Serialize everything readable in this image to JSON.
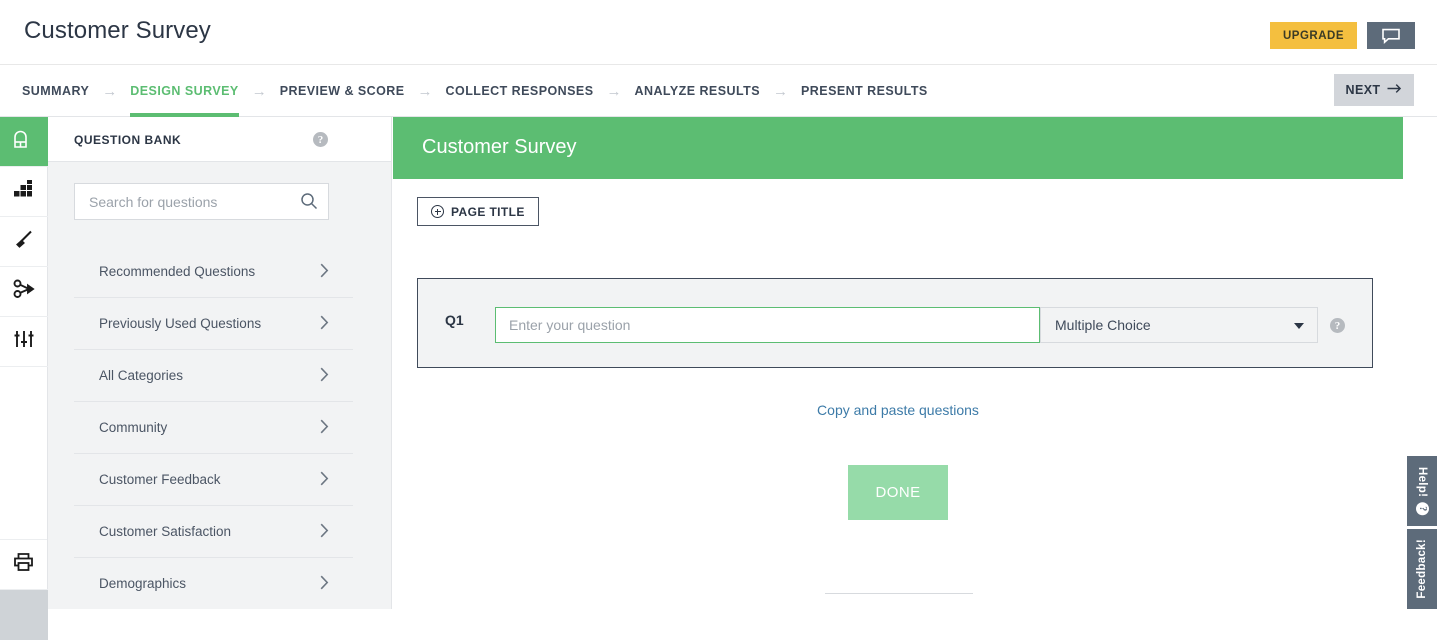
{
  "header": {
    "app_title": "Customer Survey",
    "upgrade_label": "UPGRADE",
    "chat_icon": "speech-bubble-icon"
  },
  "tabbar": {
    "tabs": [
      {
        "label": "SUMMARY",
        "active": false
      },
      {
        "label": "DESIGN SURVEY",
        "active": true
      },
      {
        "label": "PREVIEW & SCORE",
        "active": false
      },
      {
        "label": "COLLECT RESPONSES",
        "active": false
      },
      {
        "label": "ANALYZE RESULTS",
        "active": false
      },
      {
        "label": "PRESENT RESULTS",
        "active": false
      }
    ],
    "next_label": "NEXT",
    "next_arrow": "→",
    "separator": "→"
  },
  "rail": {
    "items": [
      {
        "icon": "question-bank-toolbox-icon",
        "active": true
      },
      {
        "icon": "blocks-grid-icon",
        "active": false
      },
      {
        "icon": "paintbrush-icon",
        "active": false
      },
      {
        "icon": "logic-branch-icon",
        "active": false
      },
      {
        "icon": "sliders-options-icon",
        "active": false
      },
      {
        "icon": "printer-icon",
        "active": false
      }
    ]
  },
  "question_bank": {
    "title": "QUESTION BANK",
    "help_glyph": "?",
    "search": {
      "placeholder": "Search for questions",
      "value": "",
      "icon": "search-icon"
    },
    "categories": [
      {
        "label": "Recommended Questions"
      },
      {
        "label": "Previously Used Questions"
      },
      {
        "label": "All Categories"
      },
      {
        "label": "Community"
      },
      {
        "label": "Customer Feedback"
      },
      {
        "label": "Customer Satisfaction"
      },
      {
        "label": "Demographics"
      }
    ],
    "chevron_glyph": "›"
  },
  "main": {
    "banner_title": "Customer Survey",
    "page_title_button": "PAGE TITLE",
    "question": {
      "number": "Q1",
      "placeholder": "Enter your question",
      "value": "",
      "type_value": "Multiple Choice",
      "help_glyph": "?"
    },
    "copy_paste_link": "Copy and paste questions",
    "done_label": "DONE"
  },
  "side_tabs": {
    "help_label": "Help!",
    "help_glyph": "?",
    "feedback_label": "Feedback!"
  },
  "colors": {
    "brand_green": "#5cbd72",
    "upgrade_amber": "#f4bf3f",
    "slate": "#5d6b7a",
    "link_blue": "#3d7ba8",
    "done_green": "#96dba9",
    "panel_gray": "#f2f3f4"
  }
}
